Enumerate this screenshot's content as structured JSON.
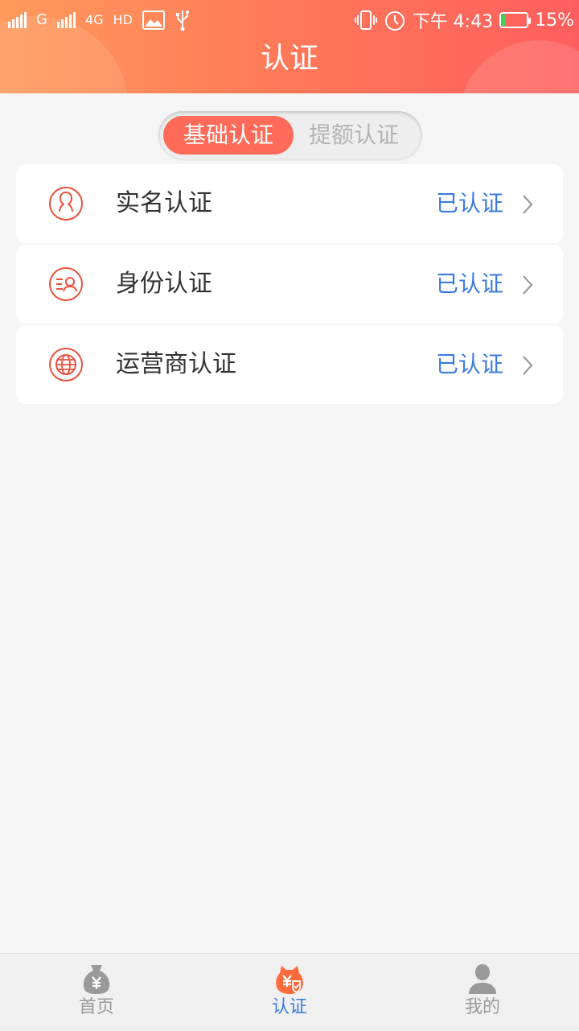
{
  "status_bar": {
    "carrier_g": "G",
    "network": "4G",
    "hd": "HD",
    "time": "下午 4:43",
    "battery": "15%"
  },
  "header": {
    "title": "认证"
  },
  "segmented": {
    "tabs": [
      {
        "label": "基础认证",
        "selected": true
      },
      {
        "label": "提额认证",
        "selected": false
      }
    ]
  },
  "verification_items": [
    {
      "label": "实名认证",
      "status": "已认证",
      "icon": "user-profile-icon"
    },
    {
      "label": "身份认证",
      "status": "已认证",
      "icon": "id-card-icon"
    },
    {
      "label": "运营商认证",
      "status": "已认证",
      "icon": "globe-operator-icon"
    }
  ],
  "tabbar": {
    "items": [
      {
        "label": "首页",
        "icon": "money-bag-icon",
        "active": false
      },
      {
        "label": "认证",
        "icon": "verify-money-icon",
        "active": true
      },
      {
        "label": "我的",
        "icon": "person-icon",
        "active": false
      }
    ]
  },
  "colors": {
    "header_gradient_start": "#ff9a5c",
    "header_gradient_end": "#ff5e5e",
    "accent_orange": "#ff6b58",
    "icon_red": "#e8513c",
    "status_blue": "#3a7be0",
    "active_tab_blue": "#3a7be0",
    "inactive_gray": "#9a9a9a",
    "background": "#f5f5f5",
    "battery_green": "#3cd05c"
  }
}
